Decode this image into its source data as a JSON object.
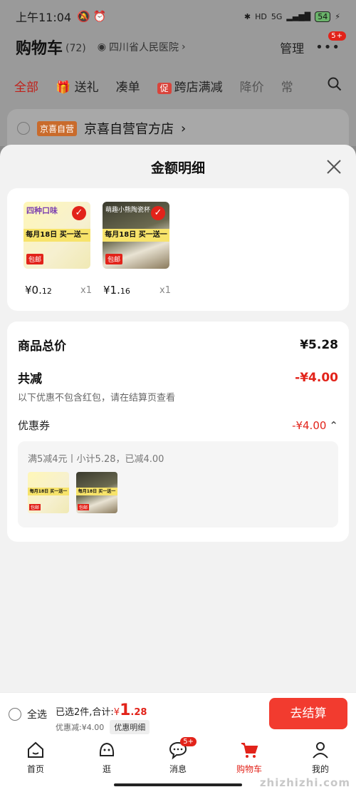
{
  "status": {
    "time": "上午11:04",
    "battery": "54",
    "network": "5G"
  },
  "header": {
    "title": "购物车",
    "count": "(72)",
    "location": "四川省人民医院",
    "manage": "管理",
    "more_badge": "5+"
  },
  "tabs": [
    "全部",
    "送礼",
    "凑单",
    "跨店满减",
    "降价",
    "常"
  ],
  "promo_tag": "促",
  "store": {
    "tag": "京喜自营",
    "name": "京喜自营官方店"
  },
  "sheet": {
    "title": "金额明细",
    "products": [
      {
        "price_int": "¥0.",
        "price_dec": "12",
        "qty": "x1",
        "banner": "每月18日 买一送一",
        "top": "四种口味",
        "ship": "包邮"
      },
      {
        "price_int": "¥1.",
        "price_dec": "16",
        "qty": "x1",
        "banner": "每月18日 买一送一",
        "top": "萌趣小熊陶瓷杯",
        "ship": "包邮"
      }
    ],
    "total_label": "商品总价",
    "total_value": "¥5.28",
    "reduce_label": "共减",
    "reduce_value": "-¥4.00",
    "reduce_note": "以下优惠不包含红包，请在结算页查看",
    "coupon_label": "优惠券",
    "coupon_value": "-¥4.00",
    "coupon_desc": "满5减4元丨小计5.28，已减4.00"
  },
  "checkout": {
    "select_all": "全选",
    "selected": "已选2件,合计:",
    "yen": "¥",
    "amount_int": "1",
    "amount_dec": ".28",
    "discount": "优惠减:¥4.00",
    "detail_tag": "优惠明细",
    "button": "去结算"
  },
  "tabbar": [
    {
      "label": "首页",
      "icon": "home-icon"
    },
    {
      "label": "逛",
      "icon": "discover-icon"
    },
    {
      "label": "消息",
      "icon": "message-icon",
      "badge": "5+"
    },
    {
      "label": "购物车",
      "icon": "cart-icon"
    },
    {
      "label": "我的",
      "icon": "profile-icon"
    }
  ],
  "watermark": "zhizhizhi.com",
  "colors": {
    "accent": "#e2231a",
    "button": "#f23b2f",
    "background": "#f2f2f2"
  }
}
